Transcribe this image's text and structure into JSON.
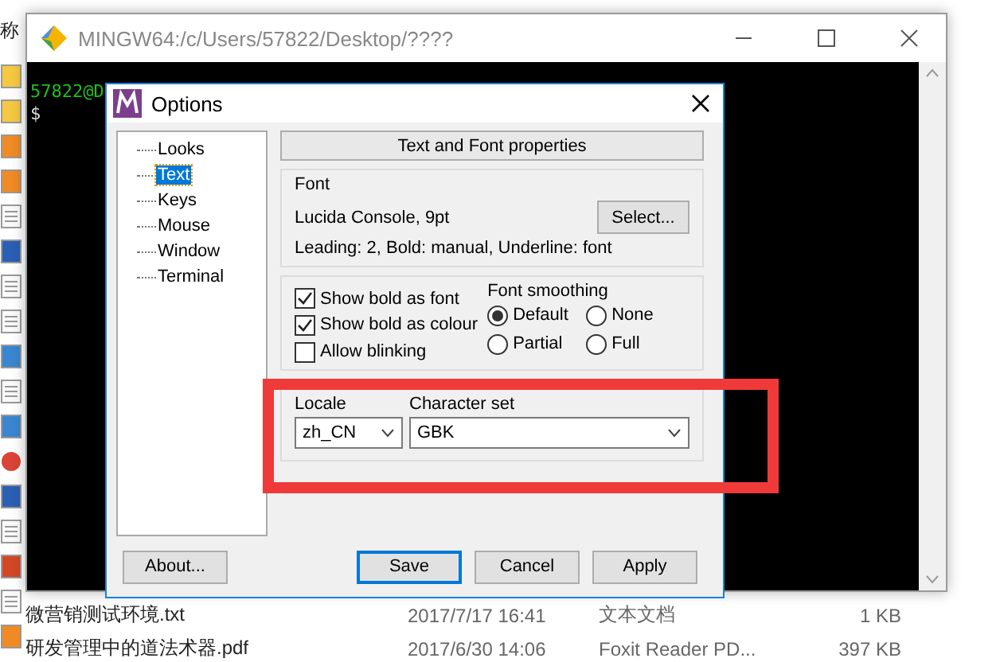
{
  "explorer": {
    "header": "称",
    "icons": [
      {
        "kind": "folder"
      },
      {
        "kind": "folder"
      },
      {
        "kind": "pdf"
      },
      {
        "kind": "pdf"
      },
      {
        "kind": "doc"
      },
      {
        "kind": "word"
      },
      {
        "kind": "doc"
      },
      {
        "kind": "doc"
      },
      {
        "kind": "image"
      },
      {
        "kind": "doc"
      },
      {
        "kind": "image"
      },
      {
        "kind": "chrome"
      },
      {
        "kind": "word"
      },
      {
        "kind": "doc"
      },
      {
        "kind": "ppt"
      },
      {
        "kind": "doc"
      },
      {
        "kind": "pdf"
      }
    ],
    "files": [
      {
        "name": "微营销测试环境.txt",
        "date": "2017/7/17 16:41",
        "type": "文本文档",
        "size": "1 KB"
      },
      {
        "name": "研发管理中的道法术器.pdf",
        "date": "2017/6/30 14:06",
        "type": "Foxit Reader PD...",
        "size": "397 KB"
      }
    ]
  },
  "terminal": {
    "title": "MINGW64:/c/Users/57822/Desktop/????",
    "lines": [
      {
        "text": "57822@D",
        "kind": "prompt"
      },
      {
        "text": "$",
        "kind": "input"
      }
    ]
  },
  "dialog": {
    "title": "Options",
    "tree": [
      {
        "label": "Looks",
        "selected": false
      },
      {
        "label": "Text",
        "selected": true
      },
      {
        "label": "Keys",
        "selected": false
      },
      {
        "label": "Mouse",
        "selected": false
      },
      {
        "label": "Window",
        "selected": false
      },
      {
        "label": "Terminal",
        "selected": false
      }
    ],
    "header": "Text and Font properties",
    "font_group": {
      "title": "Font",
      "font": "Lucida Console, 9pt",
      "details": "Leading: 2, Bold: manual, Underline: font",
      "button": "Select..."
    },
    "checkboxes": [
      {
        "label": "Show bold as font",
        "checked": true
      },
      {
        "label": "Show bold as colour",
        "checked": true
      },
      {
        "label": "Allow blinking",
        "checked": false
      }
    ],
    "smoothing": {
      "title": "Font smoothing",
      "options": [
        {
          "label": "Default",
          "selected": true
        },
        {
          "label": "None",
          "selected": false
        },
        {
          "label": "Partial",
          "selected": false
        },
        {
          "label": "Full",
          "selected": false
        }
      ]
    },
    "locale": {
      "label": "Locale",
      "value": "zh_CN"
    },
    "charset": {
      "label": "Character set",
      "value": "GBK"
    },
    "buttons": [
      {
        "label": "About...",
        "kind": "about"
      },
      {
        "label": "Save",
        "kind": "default"
      },
      {
        "label": "Cancel",
        "kind": "normal"
      },
      {
        "label": "Apply",
        "kind": "normal"
      }
    ]
  },
  "annotation": {
    "kind": "rectangle"
  }
}
